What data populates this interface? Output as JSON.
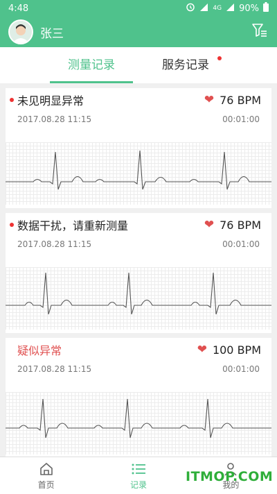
{
  "status_bar": {
    "time": "4:48",
    "network": "4G",
    "battery": "90%"
  },
  "header": {
    "user_name": "张三"
  },
  "tabs": [
    {
      "label": "测量记录",
      "active": true
    },
    {
      "label": "服务记录",
      "active": false,
      "has_badge": true
    }
  ],
  "records": [
    {
      "status": "未见明显异常",
      "bpm": "76 BPM",
      "datetime": "2017.08.28 11:15",
      "duration": "00:01:00",
      "abnormal": false
    },
    {
      "status": "数据干扰，请重新测量",
      "bpm": "76 BPM",
      "datetime": "2017.08.28 11:15",
      "duration": "00:01:00",
      "abnormal": false
    },
    {
      "status": "疑似异常",
      "bpm": "100 BPM",
      "datetime": "2017.08.28 11:15",
      "duration": "00:01:00",
      "abnormal": true
    }
  ],
  "bottom_nav": [
    {
      "label": "首页",
      "icon": "home-icon"
    },
    {
      "label": "记录",
      "icon": "list-icon",
      "active": true
    },
    {
      "label": "我的",
      "icon": "user-icon"
    }
  ],
  "watermark": "ITMOP.COM",
  "colors": {
    "brand": "#4fc28c",
    "alert": "#e05050",
    "badge": "#ee3333"
  }
}
